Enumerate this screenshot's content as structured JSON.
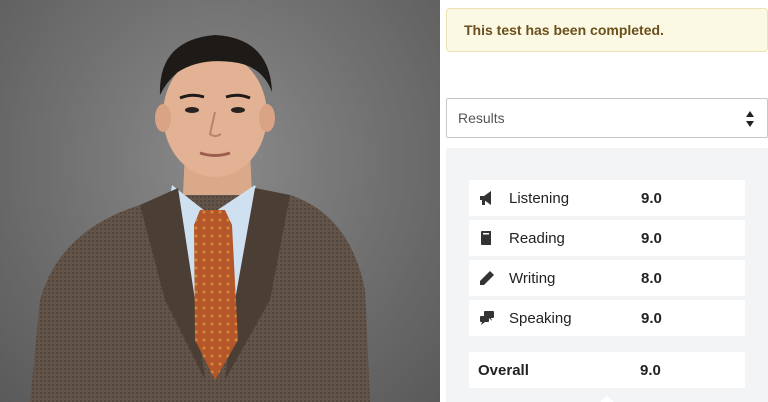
{
  "alert": {
    "text": "This test has been completed."
  },
  "results_select": {
    "selected": "Results"
  },
  "scores": [
    {
      "icon": "megaphone-icon",
      "label": "Listening",
      "score": "9.0"
    },
    {
      "icon": "book-icon",
      "label": "Reading",
      "score": "9.0"
    },
    {
      "icon": "pencil-icon",
      "label": "Writing",
      "score": "8.0"
    },
    {
      "icon": "speech-bubbles-icon",
      "label": "Speaking",
      "score": "9.0"
    }
  ],
  "overall": {
    "label": "Overall",
    "score": "9.0"
  },
  "colors": {
    "alert_bg": "#fbf8e3",
    "alert_text": "#6b4f1c",
    "panel_bg": "#f2f4f6"
  }
}
